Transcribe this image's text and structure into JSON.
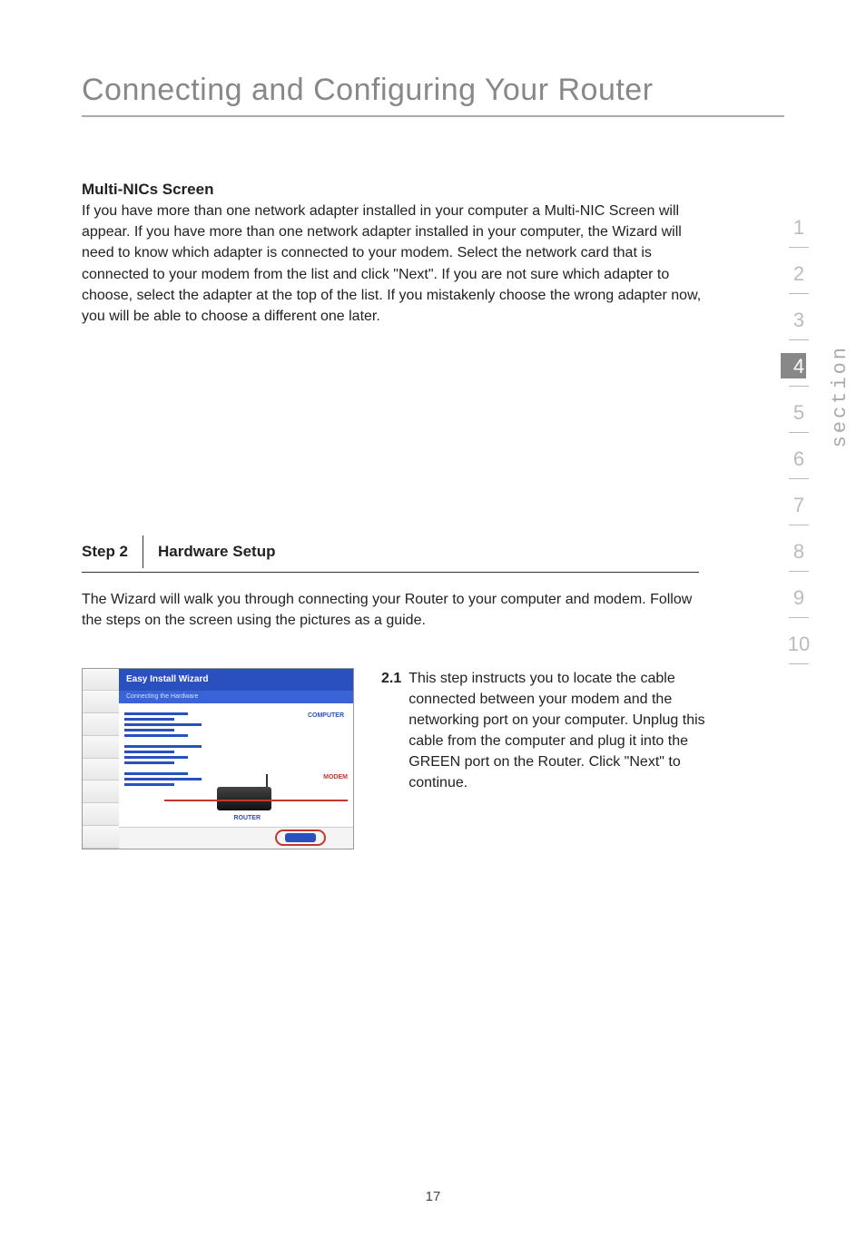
{
  "title": "Connecting and Configuring Your Router",
  "multi_nics": {
    "heading": "Multi-NICs Screen",
    "body": "If you have more than one network adapter installed in your computer a Multi-NIC Screen will appear. If you have more than one network adapter installed in your computer, the Wizard will need to know which adapter is connected to your modem. Select the network card that is connected to your modem from the list and click \"Next\". If you are not sure which adapter to choose, select the adapter at the top of the list. If you mistakenly choose the wrong adapter now, you will be able to choose a different one later."
  },
  "step2": {
    "label": "Step 2",
    "title": "Hardware Setup",
    "intro": "The Wizard will walk you through connecting your Router to your computer and modem. Follow the steps on the screen using the pictures as a guide.",
    "item_num": "2.1",
    "item_body": "This step instructs you to locate the cable connected between your modem and the networking port on your computer. Unplug this cable from the computer and plug it into the GREEN port on the Router. Click \"Next\" to continue."
  },
  "figure": {
    "header": "Easy Install Wizard",
    "subheader": "Connecting the Hardware",
    "label_computer": "COMPUTER",
    "label_modem": "MODEM",
    "label_router": "ROUTER"
  },
  "sidenav": {
    "items": [
      "1",
      "2",
      "3",
      "4",
      "5",
      "6",
      "7",
      "8",
      "9",
      "10"
    ],
    "active_index": 3,
    "section_label": "section"
  },
  "page_number": "17"
}
